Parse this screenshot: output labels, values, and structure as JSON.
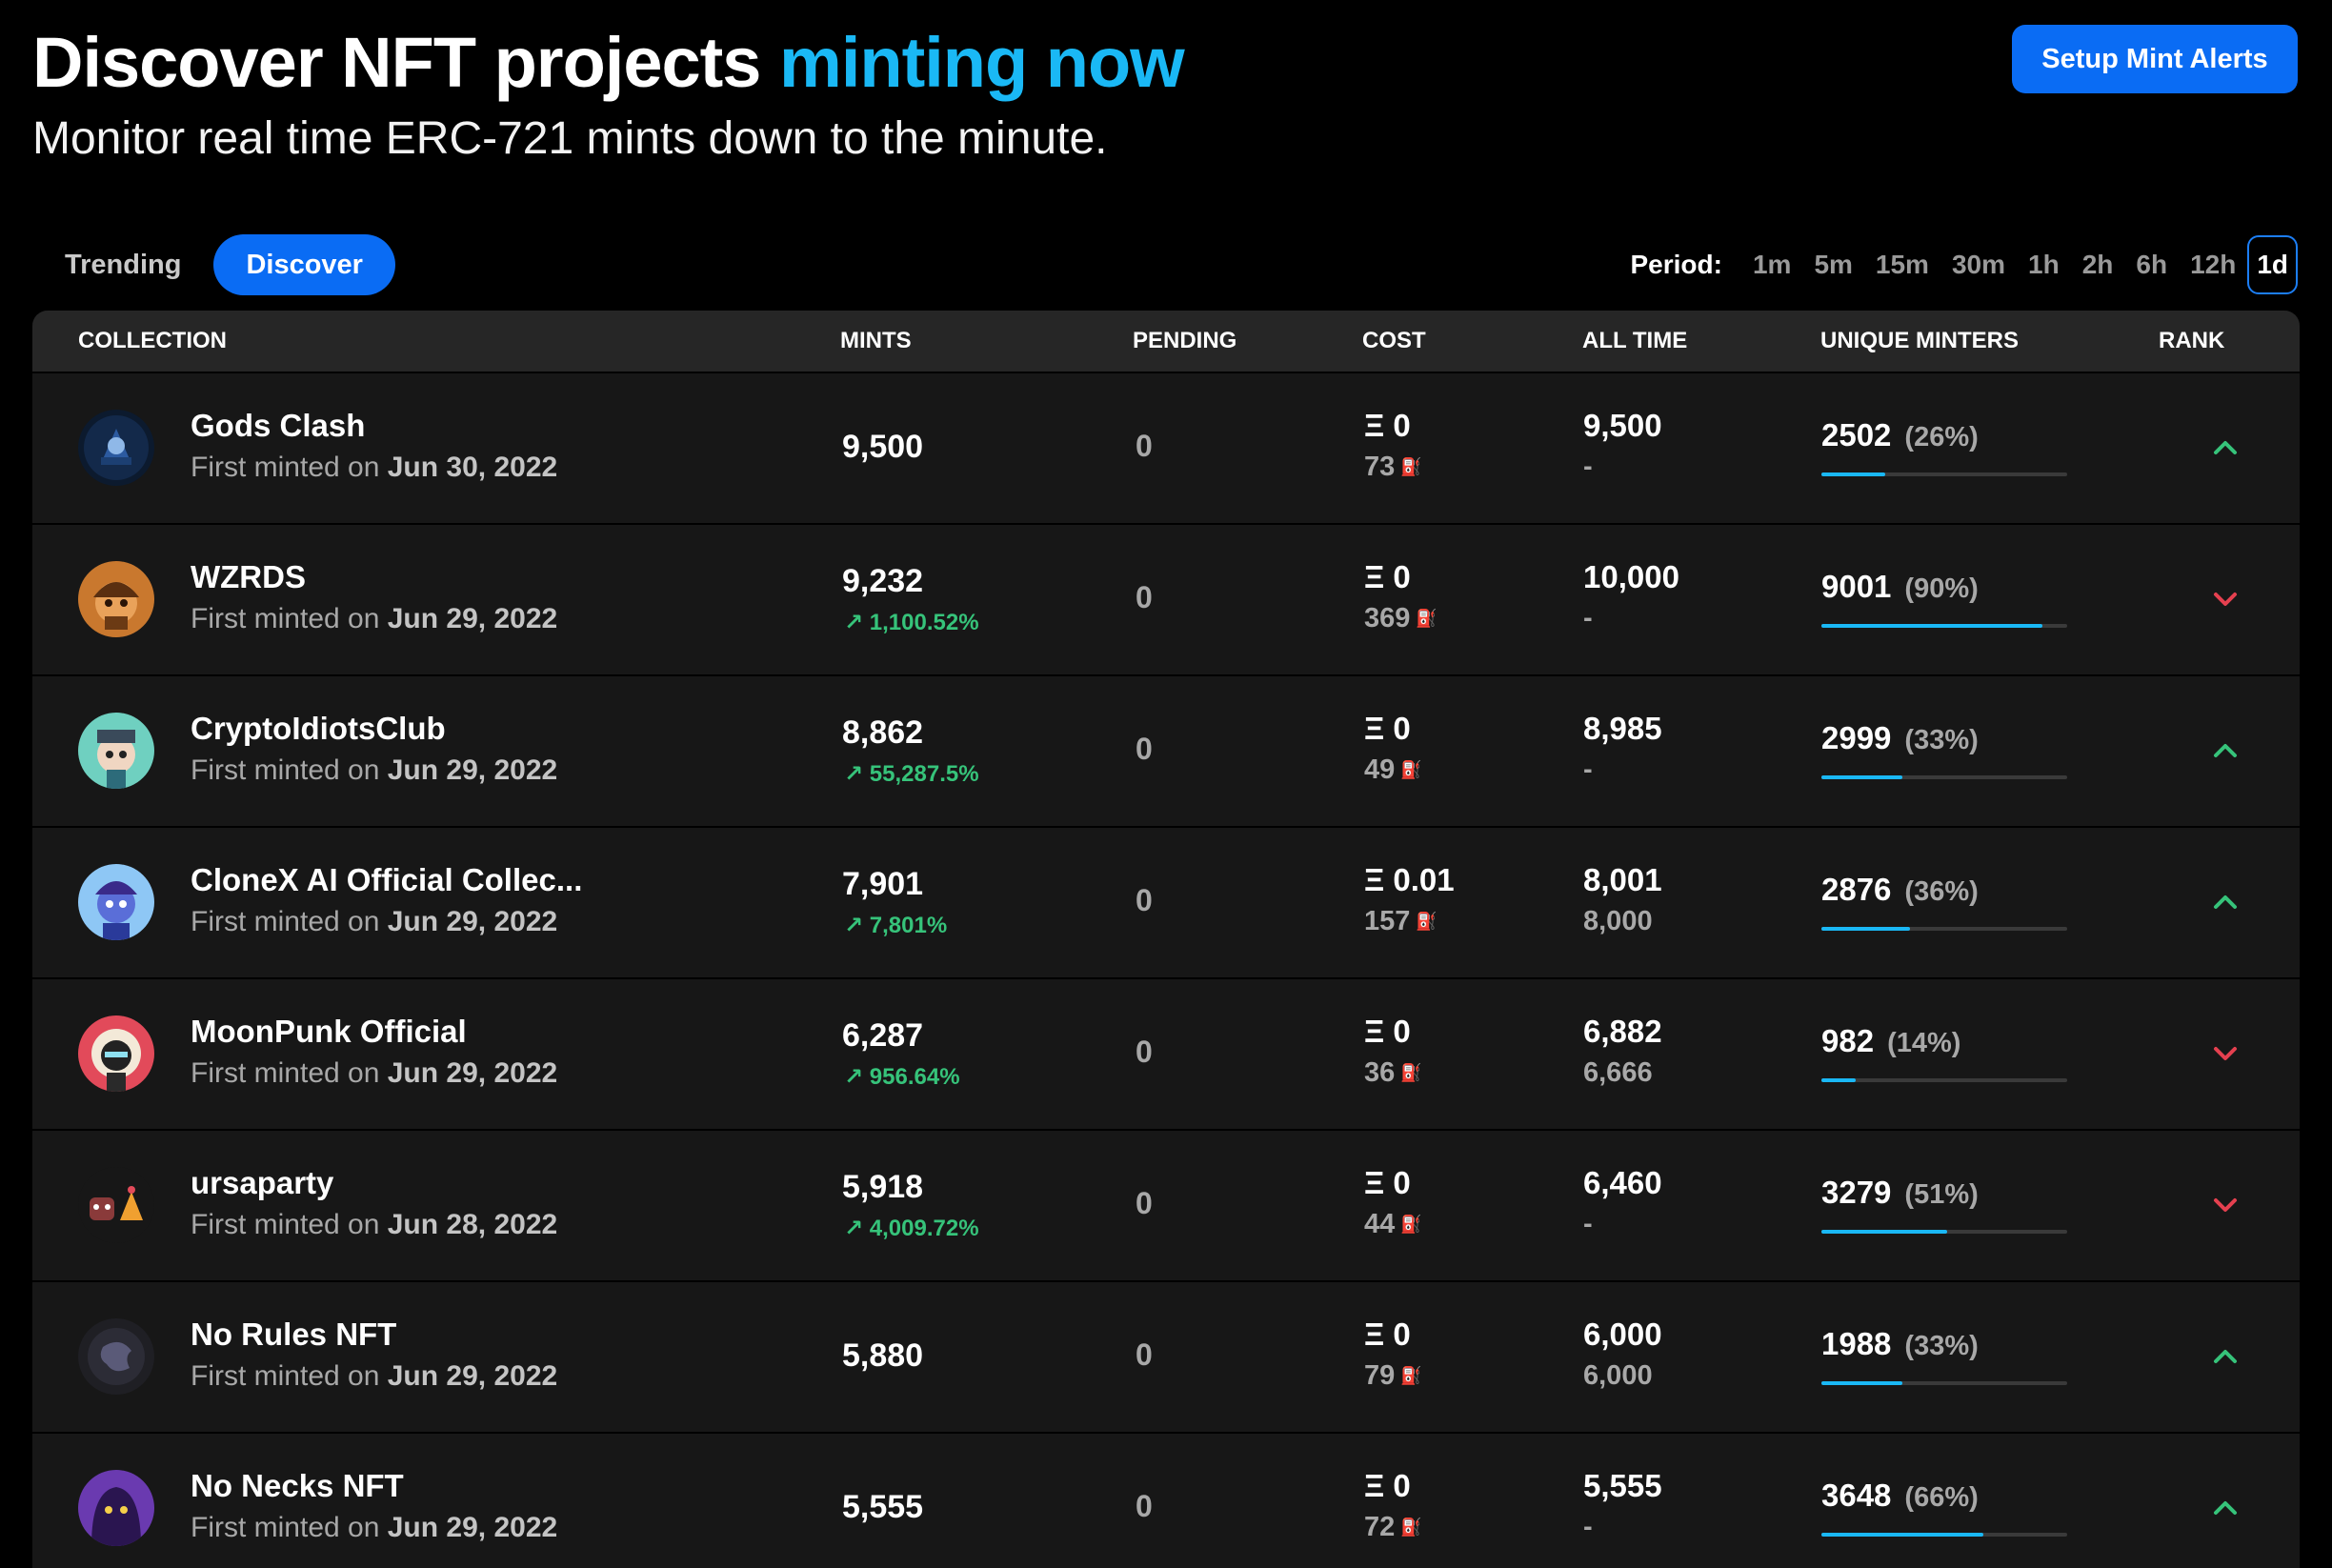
{
  "header": {
    "title_main": "Discover NFT projects",
    "title_accent": "minting now",
    "subtitle": "Monitor real time ERC-721 mints down to the minute.",
    "alert_button": "Setup Mint Alerts"
  },
  "tabs": [
    {
      "label": "Trending",
      "active": false
    },
    {
      "label": "Discover",
      "active": true
    }
  ],
  "period": {
    "label": "Period:",
    "options": [
      "1m",
      "5m",
      "15m",
      "30m",
      "1h",
      "2h",
      "6h",
      "12h",
      "1d"
    ],
    "selected": "1d"
  },
  "columns": {
    "collection": "COLLECTION",
    "mints": "MINTS",
    "pending": "PENDING",
    "cost": "COST",
    "all_time": "ALL TIME",
    "unique_minters": "UNIQUE MINTERS",
    "rank": "RANK"
  },
  "first_minted_prefix": "First minted on",
  "colors": {
    "accent": "#1ab8f5",
    "button": "#0a6cf4",
    "positive": "#36c37a",
    "negative": "#e5404f"
  },
  "rows": [
    {
      "name": "Gods Clash",
      "date": "Jun 30, 2022",
      "mints": "9,500",
      "change": "",
      "pending": "0",
      "cost": "Ξ 0",
      "cost_sub": "73",
      "all_time": "9,500",
      "all_time_sub": "-",
      "unique": "2502",
      "unique_pct": "(26%)",
      "unique_frac": 0.26,
      "rank": "up",
      "avatar": "gods-clash"
    },
    {
      "name": "WZRDS",
      "date": "Jun 29, 2022",
      "mints": "9,232",
      "change": "1,100.52%",
      "pending": "0",
      "cost": "Ξ 0",
      "cost_sub": "369",
      "all_time": "10,000",
      "all_time_sub": "-",
      "unique": "9001",
      "unique_pct": "(90%)",
      "unique_frac": 0.9,
      "rank": "down",
      "avatar": "wzrds"
    },
    {
      "name": "CryptoIdiotsClub",
      "date": "Jun 29, 2022",
      "mints": "8,862",
      "change": "55,287.5%",
      "pending": "0",
      "cost": "Ξ 0",
      "cost_sub": "49",
      "all_time": "8,985",
      "all_time_sub": "-",
      "unique": "2999",
      "unique_pct": "(33%)",
      "unique_frac": 0.33,
      "rank": "up",
      "avatar": "cryptoidiots"
    },
    {
      "name": "CloneX AI Official Collec...",
      "date": "Jun 29, 2022",
      "mints": "7,901",
      "change": "7,801%",
      "pending": "0",
      "cost": "Ξ 0.01",
      "cost_sub": "157",
      "all_time": "8,001",
      "all_time_sub": "8,000",
      "unique": "2876",
      "unique_pct": "(36%)",
      "unique_frac": 0.36,
      "rank": "up",
      "avatar": "clonex"
    },
    {
      "name": "MoonPunk Official",
      "date": "Jun 29, 2022",
      "mints": "6,287",
      "change": "956.64%",
      "pending": "0",
      "cost": "Ξ 0",
      "cost_sub": "36",
      "all_time": "6,882",
      "all_time_sub": "6,666",
      "unique": "982",
      "unique_pct": "(14%)",
      "unique_frac": 0.14,
      "rank": "down",
      "avatar": "moonpunk"
    },
    {
      "name": "ursaparty",
      "date": "Jun 28, 2022",
      "mints": "5,918",
      "change": "4,009.72%",
      "pending": "0",
      "cost": "Ξ 0",
      "cost_sub": "44",
      "all_time": "6,460",
      "all_time_sub": "-",
      "unique": "3279",
      "unique_pct": "(51%)",
      "unique_frac": 0.51,
      "rank": "down",
      "avatar": "ursaparty"
    },
    {
      "name": "No Rules NFT",
      "date": "Jun 29, 2022",
      "mints": "5,880",
      "change": "",
      "pending": "0",
      "cost": "Ξ 0",
      "cost_sub": "79",
      "all_time": "6,000",
      "all_time_sub": "6,000",
      "unique": "1988",
      "unique_pct": "(33%)",
      "unique_frac": 0.33,
      "rank": "up",
      "avatar": "no-rules"
    },
    {
      "name": "No Necks NFT",
      "date": "Jun 29, 2022",
      "mints": "5,555",
      "change": "",
      "pending": "0",
      "cost": "Ξ 0",
      "cost_sub": "72",
      "all_time": "5,555",
      "all_time_sub": "-",
      "unique": "3648",
      "unique_pct": "(66%)",
      "unique_frac": 0.66,
      "rank": "up",
      "avatar": "no-necks"
    }
  ]
}
